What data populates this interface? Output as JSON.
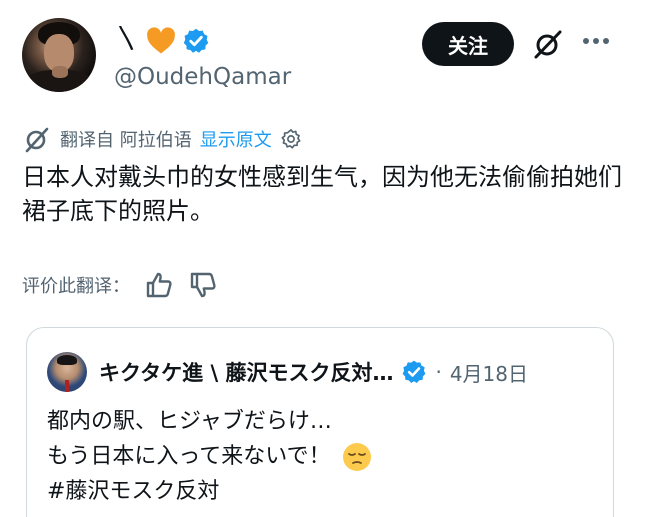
{
  "header": {
    "name": "〵",
    "handle": "@OudehQamar",
    "follow_label": "关注"
  },
  "translation": {
    "translated_from": "翻译自 阿拉伯语",
    "show_original": "显示原文"
  },
  "tweet": {
    "text": "日本人对戴头巾的女性感到生气，因为他无法偷偷拍她们裙子底下的照片。"
  },
  "rating": {
    "label": "评价此翻译："
  },
  "quote": {
    "name": "キクタケ進 \\ 藤沢モスク反対…",
    "dot": "·",
    "date": "4月18日",
    "lines": [
      "都内の駅、ヒジャブだらけ…",
      "もう日本に入って来ないで！",
      "#藤沢モスク反対"
    ]
  },
  "colors": {
    "accent": "#1d9bf0",
    "text": "#0f1419",
    "secondary": "#536471",
    "heart": "#f59a23",
    "follow_bg": "#0f1419"
  },
  "icons": [
    "heart-icon",
    "verified-icon",
    "grok-icon",
    "more-icon",
    "translate-icon",
    "settings-icon",
    "thumbs-up-icon",
    "thumbs-down-icon",
    "relieved-face-icon"
  ]
}
